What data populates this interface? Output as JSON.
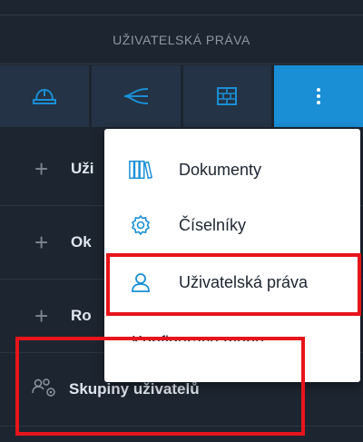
{
  "header": {
    "title": "UŽIVATELSKÁ PRÁVA"
  },
  "toolbar": {
    "buttons": [
      {
        "icon": "hard-hat-icon"
      },
      {
        "icon": "branch-arrows-icon"
      },
      {
        "icon": "brick-wall-icon"
      },
      {
        "icon": "more-vertical-icon",
        "active": true
      }
    ]
  },
  "sidebar": {
    "items": [
      {
        "label": "Uži",
        "icon": "plus-icon"
      },
      {
        "label": "Ok",
        "icon": "plus-icon"
      },
      {
        "label": "Ro",
        "icon": "plus-icon"
      },
      {
        "label": "Skupiny uživatelů",
        "icon": "user-group-gear-icon"
      }
    ]
  },
  "menu": {
    "items": [
      {
        "label": "Dokumenty",
        "icon": "books-icon"
      },
      {
        "label": "Číselníky",
        "icon": "gear-icon"
      },
      {
        "label": "Uživatelská práva",
        "icon": "user-icon"
      },
      {
        "label": "Konfigurace menu"
      }
    ]
  },
  "colors": {
    "accent": "#1a8fd6",
    "highlight": "#e8141b",
    "background": "#1d2530"
  }
}
